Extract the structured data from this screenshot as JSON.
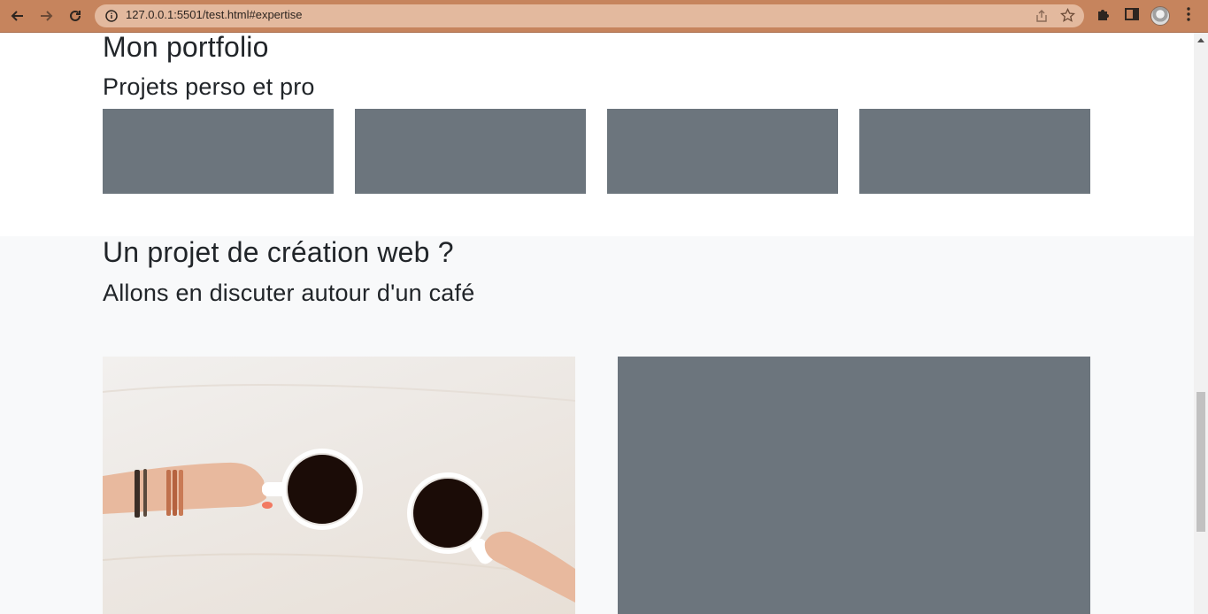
{
  "browser": {
    "url": "127.0.0.1:5501/test.html#expertise"
  },
  "portfolio": {
    "title": "Mon portfolio",
    "subtitle": "Projets perso et pro",
    "thumbnail_color": "#6c757d"
  },
  "contact": {
    "title": "Un projet de création web ?",
    "subtitle": "Allons en discuter autour d'un café",
    "photo_subject": "two-coffee-cups-hands",
    "placeholder_color": "#6c757d"
  },
  "colors": {
    "browser_frame": "#c6845d",
    "section_bg": "#f8f9fa",
    "text": "#212529"
  }
}
